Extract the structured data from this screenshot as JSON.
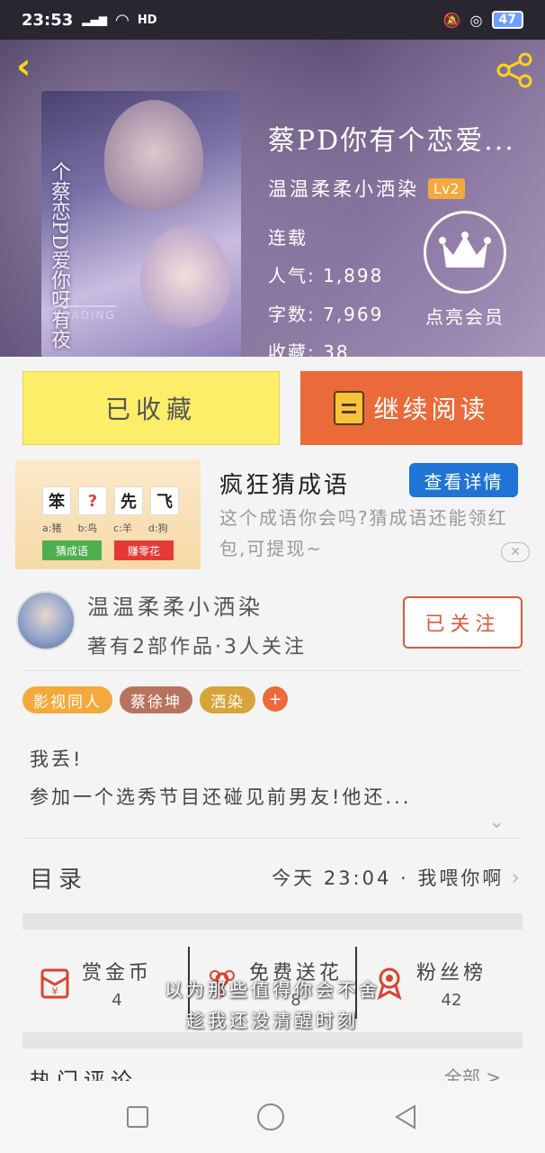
{
  "status_bar": {
    "time": "23:53",
    "network": "4G",
    "hd": "HD",
    "battery": "47"
  },
  "header": {
    "back_icon": "chevron-left-icon",
    "share_icon": "share-icon"
  },
  "book": {
    "cover_title": "个蔡恋PD爱你呀有夜",
    "cover_loading": "LOADING",
    "title": "蔡PD你有个恋爱...",
    "author": "温温柔柔小洒染",
    "level": "Lv2",
    "status": "连载",
    "popularity": "人气: 1,898",
    "word_count": "字数: 7,969",
    "favorites": "收藏: 38"
  },
  "vip": {
    "label": "点亮会员",
    "icon": "crown-icon"
  },
  "actions": {
    "collected_label": "已收藏",
    "read_label": "继续阅读"
  },
  "ad": {
    "chars": [
      "笨",
      "?",
      "先",
      "飞"
    ],
    "options": [
      "a:猪",
      "b:鸟",
      "c:羊",
      "d:狗"
    ],
    "btn_green": "猜成语",
    "btn_red": "赚零花",
    "title": "疯狂猜成语",
    "cta": "查看详情",
    "desc": "这个成语你会吗?猜成语还能领红包,可提现~"
  },
  "author_card": {
    "name": "温温柔柔小洒染",
    "subtitle": "著有2部作品·3人关注",
    "follow_label": "已关注"
  },
  "tags": [
    {
      "label": "影视同人",
      "color": "#f4a93a"
    },
    {
      "label": "蔡徐坤",
      "color": "#b8735f"
    },
    {
      "label": "洒染",
      "color": "#d6a43a"
    }
  ],
  "tag_add": "+",
  "synopsis": {
    "line1": "我丢!",
    "line2": "参加一个选秀节目还碰见前男友!他还..."
  },
  "toc": {
    "label": "目录",
    "latest": "今天 23:04 · 我喂你啊"
  },
  "stats": [
    {
      "label": "赏金币",
      "value": "4",
      "icon": "red-envelope-icon"
    },
    {
      "label": "免费送花",
      "value": "8",
      "icon": "flower-icon"
    },
    {
      "label": "粉丝榜",
      "value": "42",
      "icon": "medal-icon"
    }
  ],
  "lyrics": {
    "line1": "以为那些值得你会不舍",
    "line2": "趁我还没清醒时刻"
  },
  "comments": {
    "label": "热门评论",
    "all": "全部 >"
  }
}
